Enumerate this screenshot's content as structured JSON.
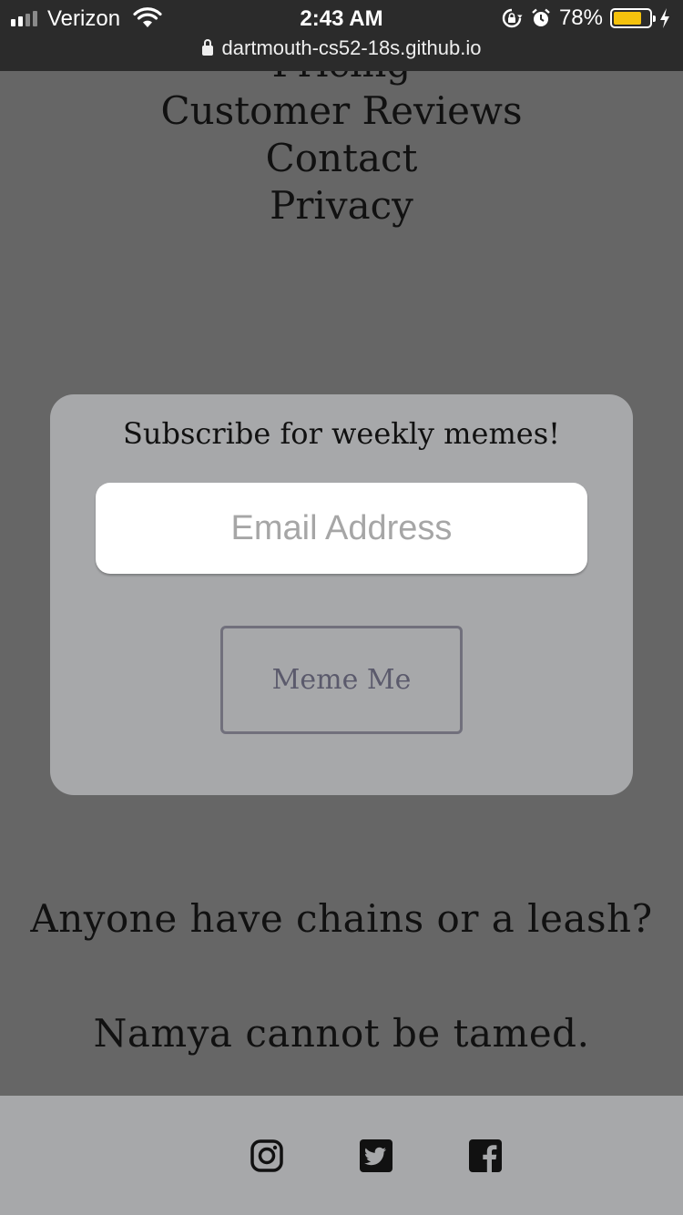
{
  "status_bar": {
    "carrier": "Verizon",
    "time": "2:43 AM",
    "battery_percent": "78%",
    "battery_level": 0.78,
    "battery_color": "#f4c20d"
  },
  "url_bar": {
    "url": "dartmouth-cs52-18s.github.io"
  },
  "nav": {
    "items": [
      "Pricing",
      "Customer Reviews",
      "Contact",
      "Privacy"
    ]
  },
  "subscribe": {
    "title": "Subscribe for weekly memes!",
    "email_placeholder": "Email Address",
    "email_value": "",
    "button_label": "Meme Me"
  },
  "headlines": {
    "line1": "Anyone have chains or a leash?",
    "line2": "Namya cannot be tamed."
  },
  "footer": {
    "icons": [
      "instagram-icon",
      "twitter-icon",
      "facebook-icon"
    ]
  },
  "colors": {
    "page_bg": "#666666",
    "card_bg": "#a7a8aa",
    "button_text": "#5b5a6c"
  }
}
